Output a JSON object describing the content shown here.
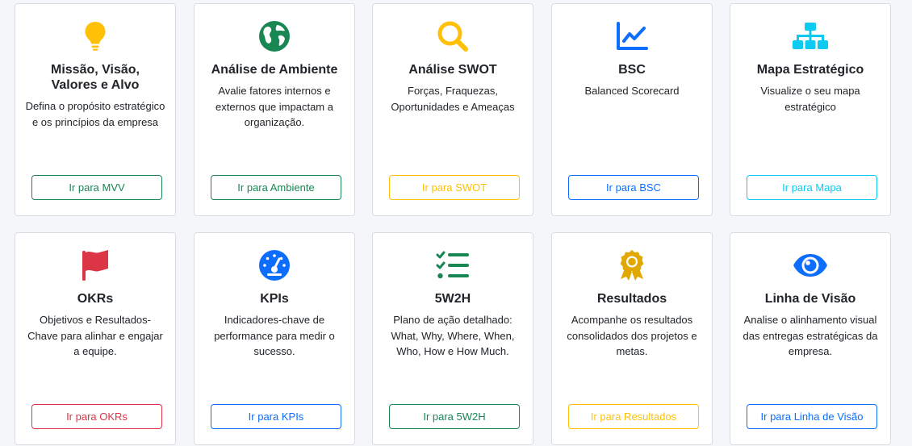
{
  "cards": [
    {
      "title": "Missão, Visão, Valores e Alvo",
      "description": "Defina o propósito estratégico e os princípios da empresa",
      "button": "Ir para MVV",
      "icon": "lightbulb-icon",
      "color": "#ffc107"
    },
    {
      "title": "Análise de Ambiente",
      "description": "Avalie fatores internos e externos que impactam a organização.",
      "button": "Ir para Ambiente",
      "icon": "globe-icon",
      "color": "#198754"
    },
    {
      "title": "Análise SWOT",
      "description": "Forças, Fraquezas, Oportunidades e Ameaças",
      "button": "Ir para SWOT",
      "icon": "search-icon",
      "color": "#ffc107"
    },
    {
      "title": "BSC",
      "description": "Balanced Scorecard",
      "button": "Ir para BSC",
      "icon": "line-chart-icon",
      "color": "#0d6efd"
    },
    {
      "title": "Mapa Estratégico",
      "description": "Visualize o seu mapa estratégico",
      "button": "Ir para Mapa",
      "icon": "org-chart-icon",
      "color": "#0dcaf0"
    },
    {
      "title": "OKRs",
      "description": "Objetivos e Resultados-Chave para alinhar e engajar a equipe.",
      "button": "Ir para OKRs",
      "icon": "flag-icon",
      "color": "#dc3545"
    },
    {
      "title": "KPIs",
      "description": "Indicadores-chave de performance para medir o sucesso.",
      "button": "Ir para KPIs",
      "icon": "speedometer-icon",
      "color": "#0d6efd"
    },
    {
      "title": "5W2H",
      "description": "Plano de ação detalhado: What, Why, Where, When, Who, How e How Much.",
      "button": "Ir para 5W2H",
      "icon": "checklist-icon",
      "color": "#198754"
    },
    {
      "title": "Resultados",
      "description": "Acompanhe os resultados consolidados dos projetos e metas.",
      "button": "Ir para Resultados",
      "icon": "award-icon",
      "color": "#ffc107"
    },
    {
      "title": "Linha de Visão",
      "description": "Analise o alinhamento visual das entregas estratégicas da empresa.",
      "button": "Ir para Linha de Visão",
      "icon": "eye-icon",
      "color": "#0d6efd"
    }
  ]
}
